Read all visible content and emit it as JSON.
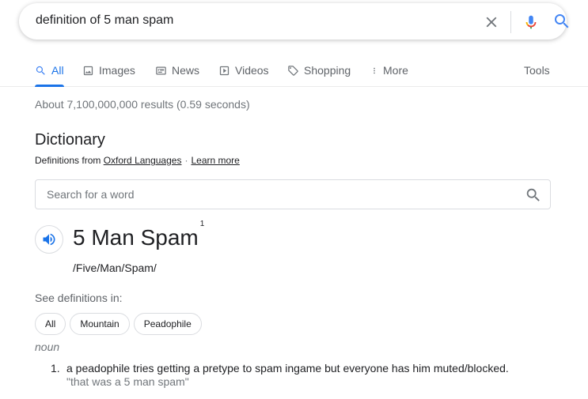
{
  "search": {
    "query": "definition of 5 man spam"
  },
  "tabs": [
    {
      "label": "All",
      "icon": "search-icon",
      "active": true
    },
    {
      "label": "Images",
      "icon": "image-icon"
    },
    {
      "label": "News",
      "icon": "news-icon"
    },
    {
      "label": "Videos",
      "icon": "play-icon"
    },
    {
      "label": "Shopping",
      "icon": "tag-icon"
    },
    {
      "label": "More",
      "icon": "more-vert-icon"
    }
  ],
  "tools_label": "Tools",
  "results_stats": "About 7,100,000,000 results (0.59 seconds)",
  "dictionary": {
    "title": "Dictionary",
    "source_prefix": "Definitions from",
    "source_link": "Oxford Languages",
    "separator": "·",
    "learn_more": "Learn more",
    "word_search_placeholder": "Search for a word",
    "headword": "5 Man Spam",
    "superscript": "1",
    "phonetic": "/Five/Man/Spam/",
    "see_definitions_label": "See definitions in:",
    "chips": [
      "All",
      "Mountain",
      "Peadophile"
    ],
    "part_of_speech": "noun",
    "definitions": [
      {
        "number": "1.",
        "text": "a peadophile tries getting a pretype to spam ingame but everyone has him muted/blocked.",
        "example": "\"that was a 5 man spam\""
      }
    ]
  },
  "colors": {
    "accent": "#1a73e8",
    "muted": "#70757a"
  }
}
